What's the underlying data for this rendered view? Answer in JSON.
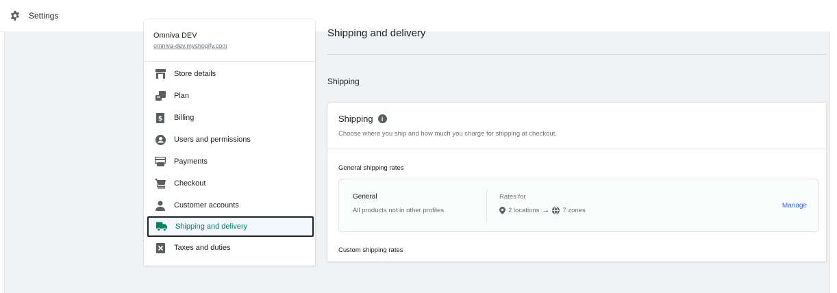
{
  "topbar": {
    "title": "Settings",
    "icon": "gear-icon"
  },
  "store": {
    "name": "Omniva DEV",
    "domain": "omniva-dev.myshopify.com"
  },
  "nav": {
    "items": [
      {
        "label": "Store details",
        "icon": "store-icon"
      },
      {
        "label": "Plan",
        "icon": "plan-icon"
      },
      {
        "label": "Billing",
        "icon": "billing-icon"
      },
      {
        "label": "Users and permissions",
        "icon": "user-circle-icon"
      },
      {
        "label": "Payments",
        "icon": "payments-icon"
      },
      {
        "label": "Checkout",
        "icon": "cart-icon"
      },
      {
        "label": "Customer accounts",
        "icon": "person-icon"
      },
      {
        "label": "Shipping and delivery",
        "icon": "truck-icon",
        "active": true
      },
      {
        "label": "Taxes and duties",
        "icon": "tax-icon"
      }
    ],
    "active_color": "#008060"
  },
  "main": {
    "title": "Shipping and delivery",
    "section_title": "Shipping",
    "card": {
      "title": "Shipping",
      "description": "Choose where you ship and how much you charge for shipping at checkout.",
      "general_rates_title": "General shipping rates",
      "profile": {
        "name": "General",
        "description": "All products not in other profiles",
        "rates_for_label": "Rates for",
        "locations": "2 locations",
        "zones": "7 zones",
        "manage_label": "Manage"
      },
      "custom_rates_title": "Custom shipping rates"
    }
  },
  "colors": {
    "link": "#2c6ecb",
    "background": "#f1f2f3"
  }
}
